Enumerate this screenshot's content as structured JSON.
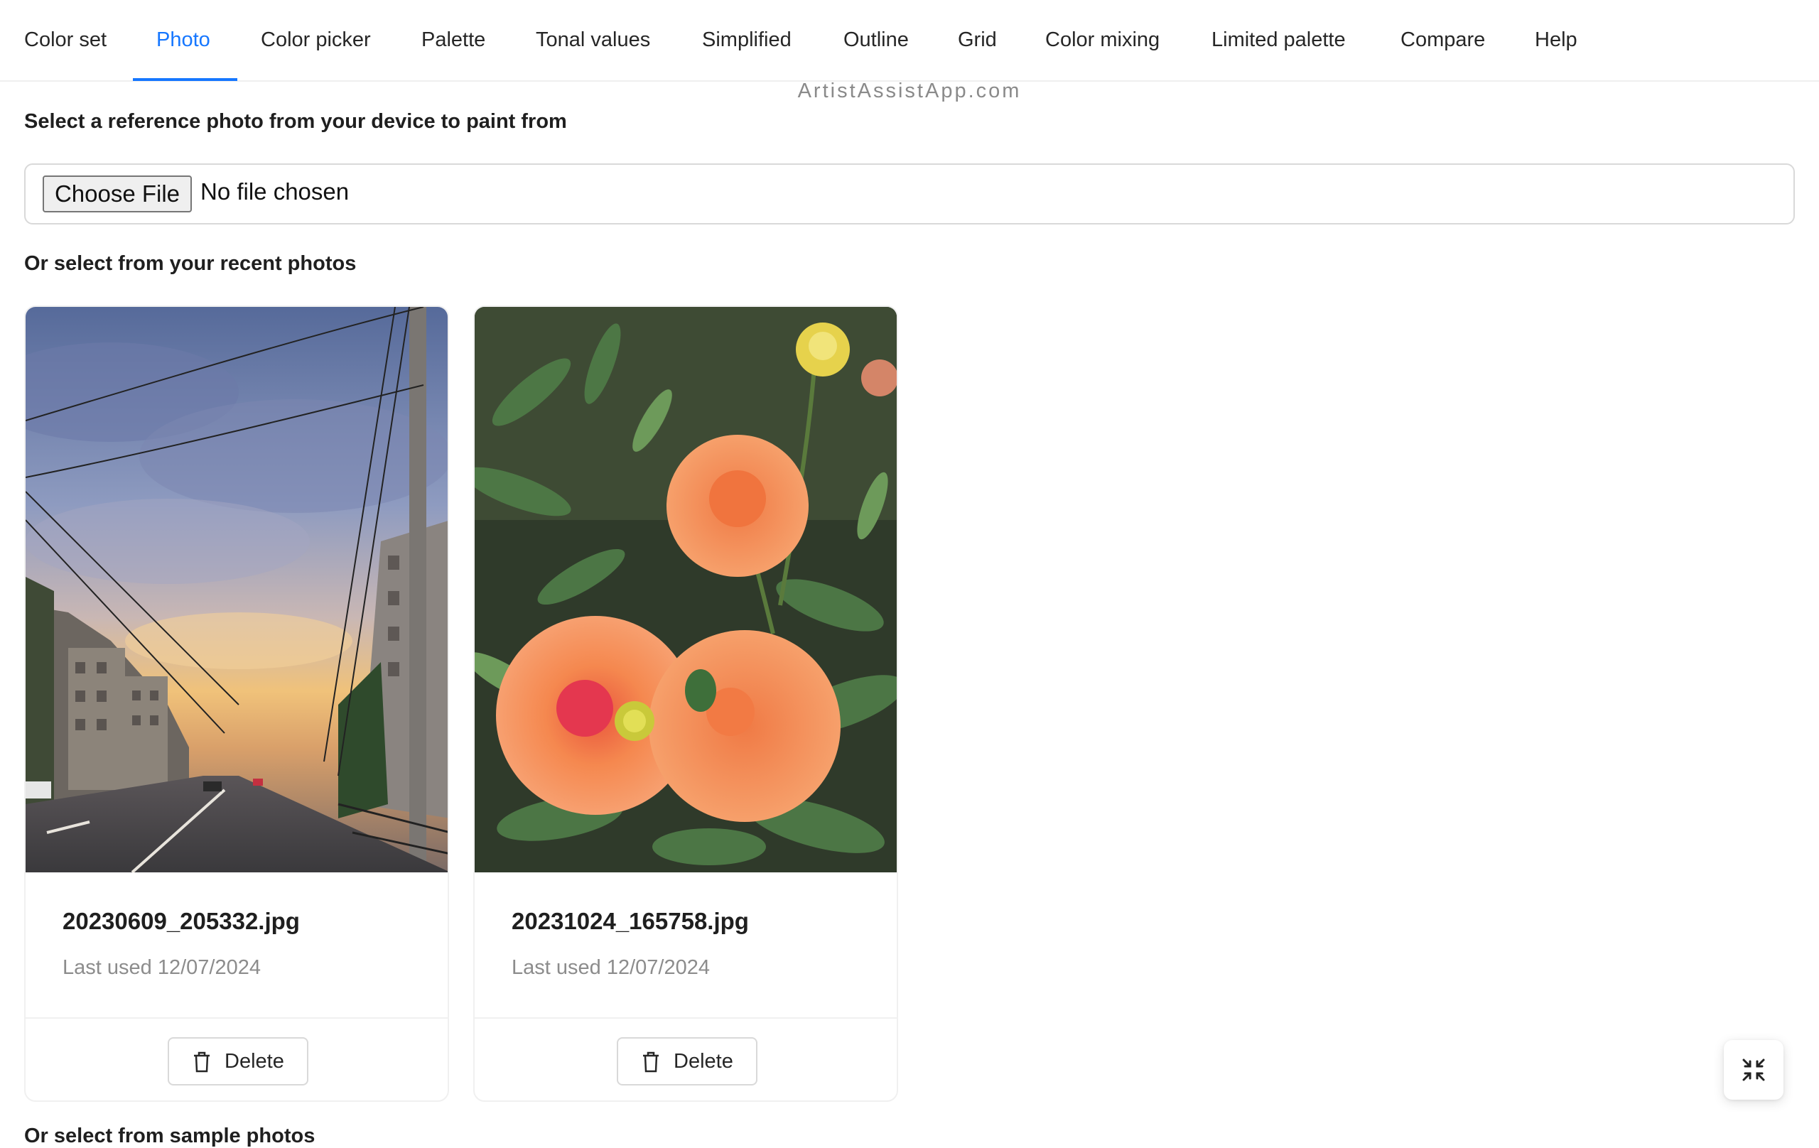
{
  "tabs": [
    {
      "label": "Color set",
      "active": false
    },
    {
      "label": "Photo",
      "active": true
    },
    {
      "label": "Color picker",
      "active": false
    },
    {
      "label": "Palette",
      "active": false
    },
    {
      "label": "Tonal values",
      "active": false
    },
    {
      "label": "Simplified",
      "active": false
    },
    {
      "label": "Outline",
      "active": false
    },
    {
      "label": "Grid",
      "active": false
    },
    {
      "label": "Color mixing",
      "active": false
    },
    {
      "label": "Limited palette",
      "active": false
    },
    {
      "label": "Compare",
      "active": false
    },
    {
      "label": "Help",
      "active": false
    }
  ],
  "watermark": "ArtistAssistApp.com",
  "upload": {
    "label": "Select a reference photo from your device to paint from",
    "button_label": "Choose File",
    "status": "No file chosen"
  },
  "recent": {
    "label": "Or select from your recent photos",
    "photos": [
      {
        "filename": "20230609_205332.jpg",
        "last_used": "Last used 12/07/2024",
        "delete_label": "Delete",
        "image": "city-street-sunset"
      },
      {
        "filename": "20231024_165758.jpg",
        "last_used": "Last used 12/07/2024",
        "delete_label": "Delete",
        "image": "orange-dahlias"
      }
    ]
  },
  "next_section_label": "Or select from sample photos",
  "float_button": {
    "icon": "compress-icon"
  },
  "colors": {
    "accent": "#1677ff",
    "border": "#d9d9d9",
    "muted_text": "#8c8c8c"
  }
}
